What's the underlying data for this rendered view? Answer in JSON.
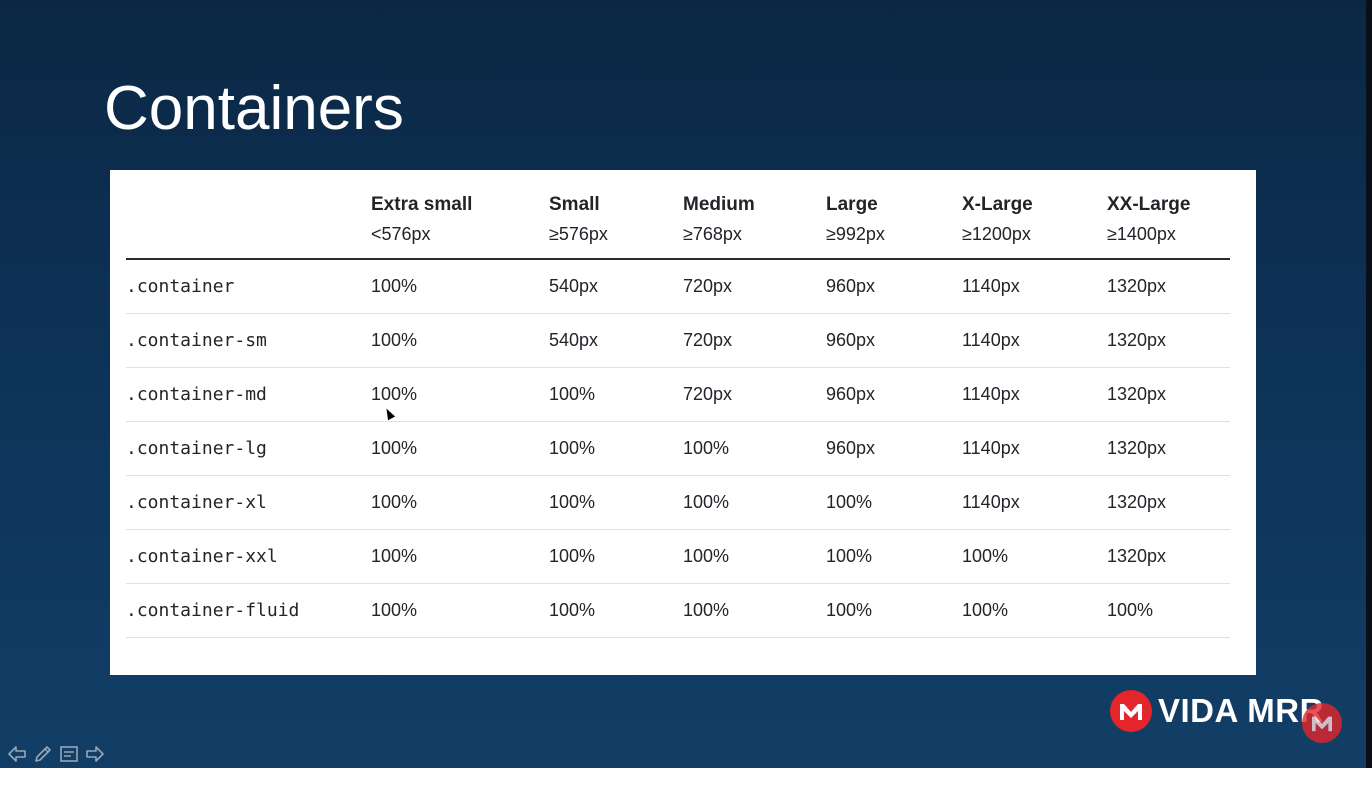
{
  "slide": {
    "title": "Containers"
  },
  "table": {
    "columns": [
      {
        "name": "Extra small",
        "range": "<576px"
      },
      {
        "name": "Small",
        "range": "≥576px"
      },
      {
        "name": "Medium",
        "range": "≥768px"
      },
      {
        "name": "Large",
        "range": "≥992px"
      },
      {
        "name": "X-Large",
        "range": "≥1200px"
      },
      {
        "name": "XX-Large",
        "range": "≥1400px"
      }
    ],
    "rows": [
      {
        "class": ".container",
        "values": [
          "100%",
          "540px",
          "720px",
          "960px",
          "1140px",
          "1320px"
        ]
      },
      {
        "class": ".container-sm",
        "values": [
          "100%",
          "540px",
          "720px",
          "960px",
          "1140px",
          "1320px"
        ]
      },
      {
        "class": ".container-md",
        "values": [
          "100%",
          "100%",
          "720px",
          "960px",
          "1140px",
          "1320px"
        ]
      },
      {
        "class": ".container-lg",
        "values": [
          "100%",
          "100%",
          "100%",
          "960px",
          "1140px",
          "1320px"
        ]
      },
      {
        "class": ".container-xl",
        "values": [
          "100%",
          "100%",
          "100%",
          "100%",
          "1140px",
          "1320px"
        ]
      },
      {
        "class": ".container-xxl",
        "values": [
          "100%",
          "100%",
          "100%",
          "100%",
          "100%",
          "1320px"
        ]
      },
      {
        "class": ".container-fluid",
        "values": [
          "100%",
          "100%",
          "100%",
          "100%",
          "100%",
          "100%"
        ]
      }
    ]
  },
  "brand": {
    "name": "VIDA MRR"
  },
  "toolbar": {
    "icons": [
      "previous-arrow-icon",
      "pen-icon",
      "slides-menu-icon",
      "next-arrow-icon"
    ]
  },
  "colors": {
    "background_top": "#0b2744",
    "background_bottom": "#123e66",
    "class_name": "#d63384",
    "muted_value": "#6c757d",
    "brand_red": "#e3262b"
  }
}
